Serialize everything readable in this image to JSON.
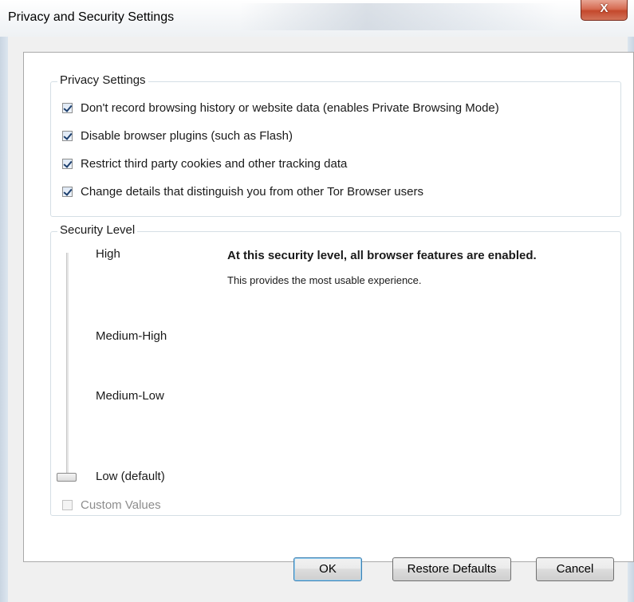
{
  "window": {
    "title": "Privacy and Security Settings",
    "close_glyph": "X"
  },
  "privacy": {
    "legend": "Privacy Settings",
    "options": [
      {
        "label": "Don't record browsing history or website data (enables Private Browsing Mode)",
        "checked": true
      },
      {
        "label": "Disable browser plugins (such as Flash)",
        "checked": true
      },
      {
        "label": "Restrict third party cookies and other tracking data",
        "checked": true
      },
      {
        "label": "Change details that distinguish you from other Tor Browser users",
        "checked": true
      }
    ]
  },
  "security": {
    "legend": "Security Level",
    "levels": [
      "High",
      "Medium-High",
      "Medium-Low",
      "Low (default)"
    ],
    "selected_level": "Low (default)",
    "description_title": "At this security level, all browser features are enabled.",
    "description_body": "This provides the most usable experience.",
    "custom_values": {
      "label": "Custom Values",
      "checked": false,
      "enabled": false
    }
  },
  "buttons": {
    "ok": "OK",
    "restore": "Restore Defaults",
    "cancel": "Cancel"
  },
  "colors": {
    "close_button": "#c4482c",
    "checkbox_check": "#1c3f6e",
    "default_button_border": "#3c7fb1"
  }
}
